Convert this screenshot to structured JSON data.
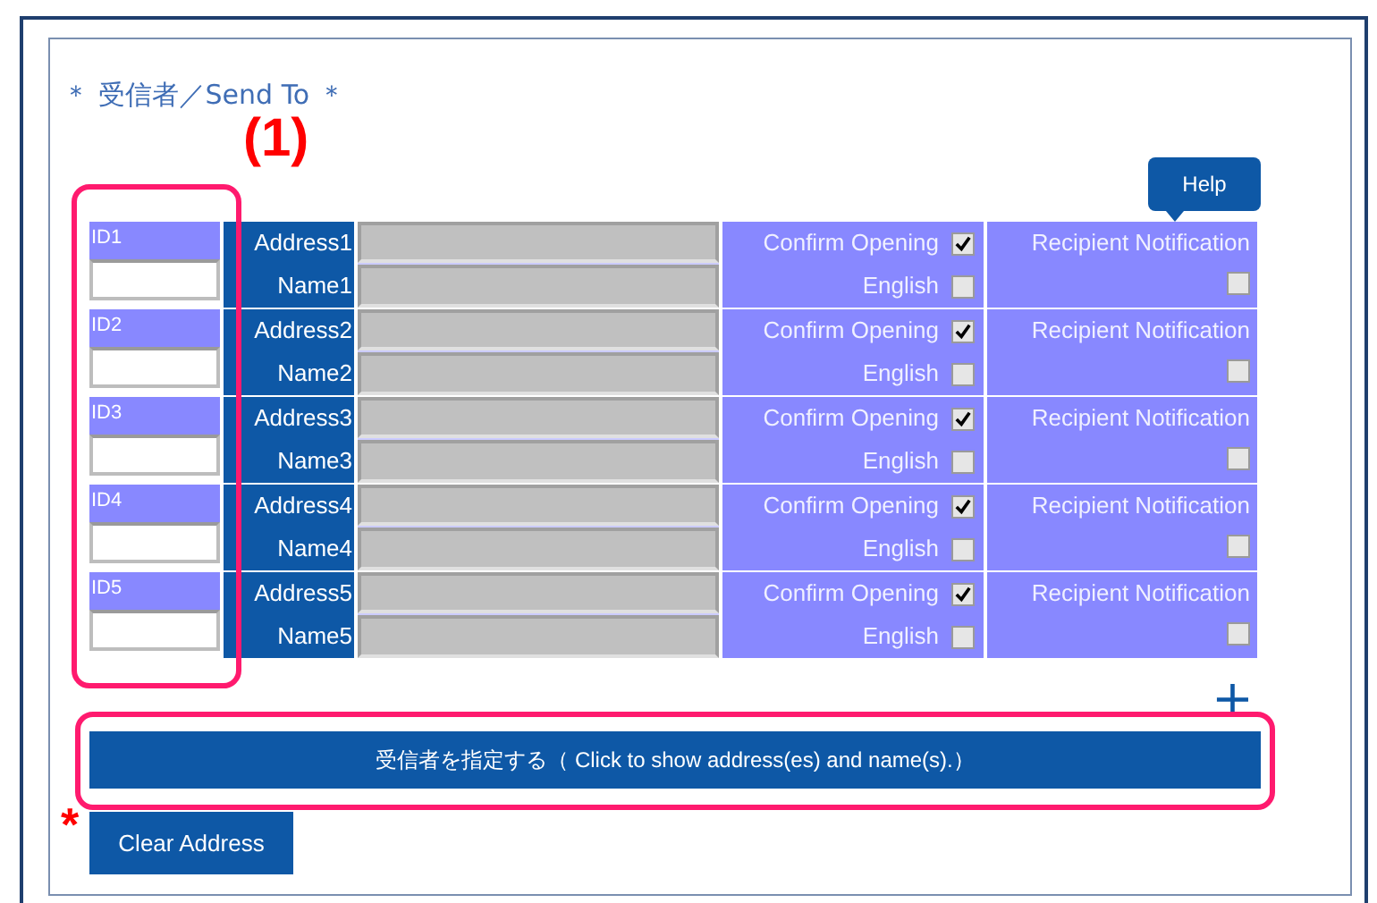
{
  "section_title": "＊ 受信者／Send To ＊",
  "annotation": "(1)",
  "help_button": "Help",
  "rows": [
    {
      "id_label": "ID1",
      "address_label": "Address1",
      "name_label": "Name1",
      "confirm_label": "Confirm Opening",
      "confirm_checked": true,
      "english_label": "English",
      "english_checked": false,
      "notify_label": "Recipient Notification",
      "notify_checked": false
    },
    {
      "id_label": "ID2",
      "address_label": "Address2",
      "name_label": "Name2",
      "confirm_label": "Confirm Opening",
      "confirm_checked": true,
      "english_label": "English",
      "english_checked": false,
      "notify_label": "Recipient Notification",
      "notify_checked": false
    },
    {
      "id_label": "ID3",
      "address_label": "Address3",
      "name_label": "Name3",
      "confirm_label": "Confirm Opening",
      "confirm_checked": true,
      "english_label": "English",
      "english_checked": false,
      "notify_label": "Recipient Notification",
      "notify_checked": false
    },
    {
      "id_label": "ID4",
      "address_label": "Address4",
      "name_label": "Name4",
      "confirm_label": "Confirm Opening",
      "confirm_checked": true,
      "english_label": "English",
      "english_checked": false,
      "notify_label": "Recipient Notification",
      "notify_checked": false
    },
    {
      "id_label": "ID5",
      "address_label": "Address5",
      "name_label": "Name5",
      "confirm_label": "Confirm Opening",
      "confirm_checked": true,
      "english_label": "English",
      "english_checked": false,
      "notify_label": "Recipient Notification",
      "notify_checked": false
    }
  ],
  "add_button": "+",
  "show_button": "受信者を指定する（ Click to show address(es) and name(s).）",
  "required_mark": "*",
  "clear_button": "Clear Address"
}
